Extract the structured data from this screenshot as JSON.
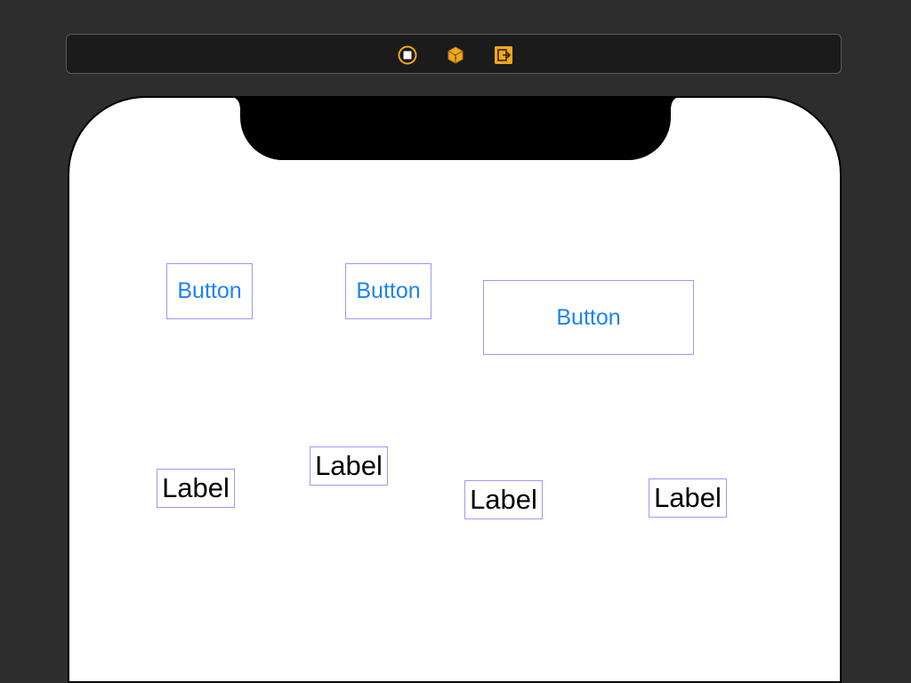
{
  "toolbar": {
    "icons": [
      {
        "name": "view-controller-icon",
        "color": "#f0a81a"
      },
      {
        "name": "first-responder-icon",
        "color": "#f0a81a"
      },
      {
        "name": "exit-icon",
        "color": "#f0a81a"
      }
    ]
  },
  "canvas": {
    "buttons": [
      {
        "title": "Button"
      },
      {
        "title": "Button"
      },
      {
        "title": "Button"
      }
    ],
    "labels": [
      {
        "text": "Label"
      },
      {
        "text": "Label"
      },
      {
        "text": "Label"
      },
      {
        "text": "Label"
      }
    ]
  },
  "colors": {
    "background": "#2d2d2d",
    "button_tint": "#1a83f5",
    "selection_outline": "#9a9af6",
    "icon_accent": "#f0a81a"
  }
}
